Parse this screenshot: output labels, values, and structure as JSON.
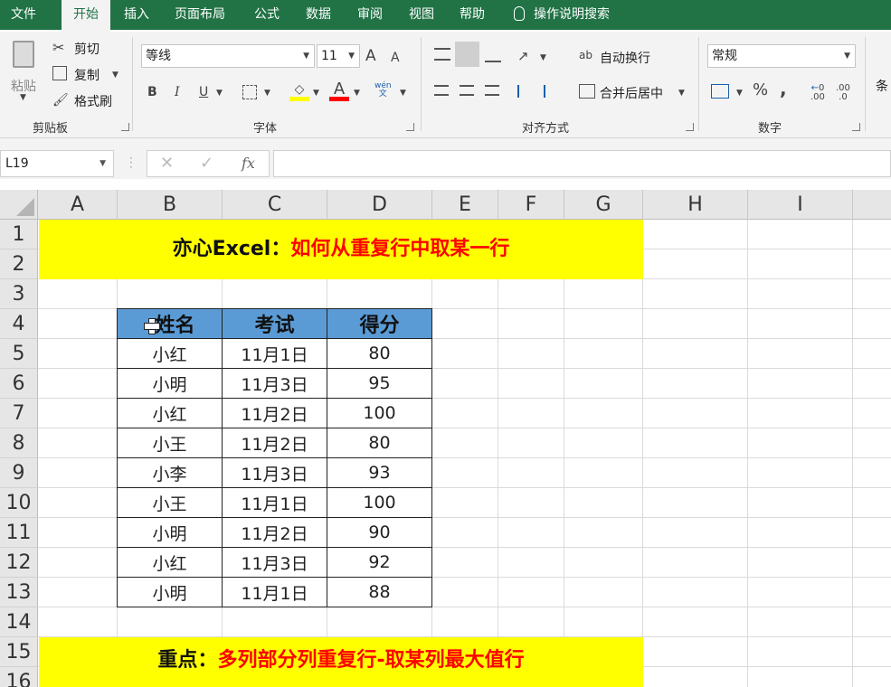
{
  "menu": {
    "tabs": [
      "文件",
      "开始",
      "插入",
      "页面布局",
      "公式",
      "数据",
      "审阅",
      "视图",
      "帮助"
    ],
    "active": "开始",
    "tell_me": "操作说明搜索"
  },
  "ribbon": {
    "clipboard": {
      "paste": "粘贴",
      "cut": "剪切",
      "copy": "复制",
      "format_painter": "格式刷",
      "label": "剪贴板"
    },
    "font": {
      "name": "等线",
      "size": "11",
      "bold": "B",
      "italic": "I",
      "underline": "U",
      "grow": "A",
      "shrink": "A",
      "font_color": "A",
      "phonetic": "wén",
      "label": "字体"
    },
    "alignment": {
      "wrap": "自动换行",
      "merge": "合并后居中",
      "label": "对齐方式"
    },
    "number": {
      "format": "常规",
      "percent": "%",
      "comma": ",",
      "inc": ".00",
      "dec": ".0",
      "label": "数字"
    },
    "styles": {
      "label": "条"
    }
  },
  "formula_bar": {
    "name_box": "L19",
    "fx": "fx",
    "value": ""
  },
  "columns": [
    "A",
    "B",
    "C",
    "D",
    "E",
    "F",
    "G",
    "H",
    "I"
  ],
  "rows": [
    "1",
    "2",
    "3",
    "4",
    "5",
    "6",
    "7",
    "8",
    "9",
    "10",
    "11",
    "12",
    "13",
    "14",
    "15",
    "16"
  ],
  "banner1": {
    "prefix": "亦心Excel：",
    "title": "如何从重复行中取某一行"
  },
  "banner2": {
    "prefix": "重点：",
    "title": "多列部分列重复行-取某列最大值行"
  },
  "table": {
    "headers": [
      "姓名",
      "考试",
      "得分"
    ],
    "rows": [
      [
        "小红",
        "11月1日",
        "80"
      ],
      [
        "小明",
        "11月3日",
        "95"
      ],
      [
        "小红",
        "11月2日",
        "100"
      ],
      [
        "小王",
        "11月2日",
        "80"
      ],
      [
        "小李",
        "11月3日",
        "93"
      ],
      [
        "小王",
        "11月1日",
        "100"
      ],
      [
        "小明",
        "11月2日",
        "90"
      ],
      [
        "小红",
        "11月3日",
        "92"
      ],
      [
        "小明",
        "11月1日",
        "88"
      ]
    ]
  },
  "colors": {
    "excel_green": "#217346",
    "header_fill": "#5b9bd5",
    "banner_fill": "#ffff00",
    "accent_red": "#ff0000"
  }
}
